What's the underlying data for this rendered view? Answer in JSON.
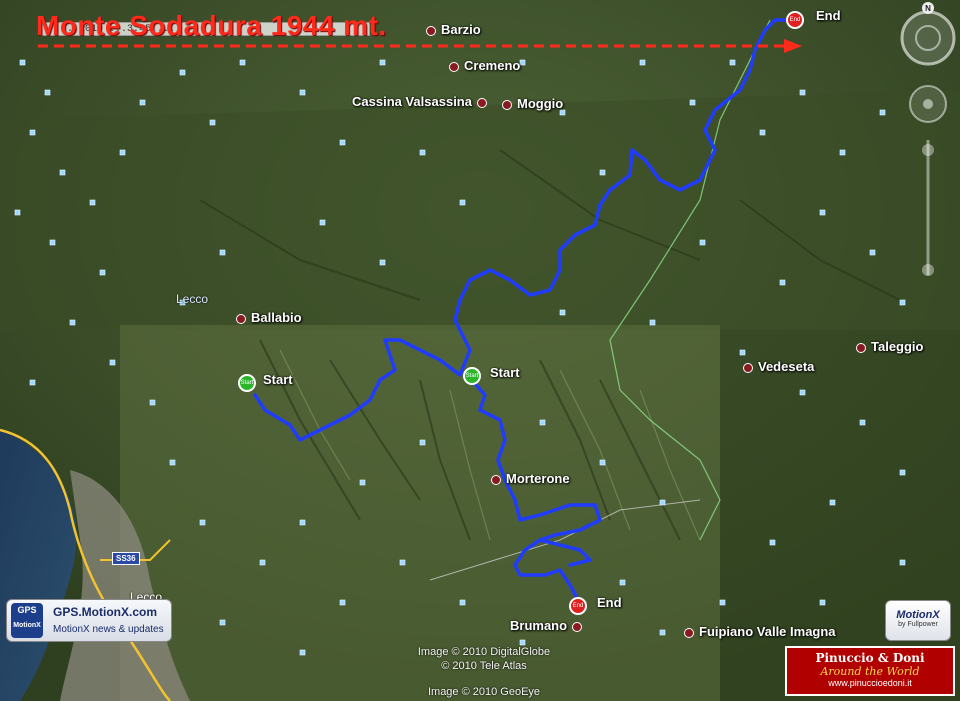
{
  "title": "Monte Sodadura 1944 mt.",
  "timestamp": "...2010 ...3:45 ...",
  "places": [
    {
      "name": "Barzio",
      "key": "barzio"
    },
    {
      "name": "Cremeno",
      "key": "cremeno"
    },
    {
      "name": "Cassina Valsassina",
      "key": "cassina"
    },
    {
      "name": "Moggio",
      "key": "moggio"
    },
    {
      "name": "Ballabio",
      "key": "ballabio"
    },
    {
      "name": "Vedeseta",
      "key": "vedeseta"
    },
    {
      "name": "Taleggio",
      "key": "taleggio"
    },
    {
      "name": "Morterone",
      "key": "morterone"
    },
    {
      "name": "Brumano",
      "key": "brumano"
    },
    {
      "name": "Fuipiano Valle Imagna",
      "key": "fuipiano"
    }
  ],
  "water_label": "Lecco",
  "town_label": "Lecco",
  "road_label": "SS36",
  "markers": {
    "start_label": "Start",
    "end_label": "End",
    "pin_start": "Start",
    "pin_end": "End"
  },
  "gps_box": {
    "logo": "GPS",
    "logo_sub": "MotionX",
    "url": "GPS.MotionX.com",
    "news": "MotionX news & updates"
  },
  "motionx": {
    "name": "MotionX",
    "sub": "by Fullpower"
  },
  "credits": {
    "line1": "Image © 2010 DigitalGlobe",
    "line2": "© 2010 Tele Atlas",
    "line3": "Image © 2010 GeoEye"
  },
  "pinuccio": {
    "line1": "Pinuccio & Doni",
    "line2": "Around the World",
    "line3": "www.pinuccioedoni.it"
  },
  "compass": {
    "north": "N"
  },
  "colors": {
    "track": "#1f3cff",
    "title": "#ff2a1a",
    "start_pin": "#2bb52b",
    "end_pin": "#e02020"
  }
}
